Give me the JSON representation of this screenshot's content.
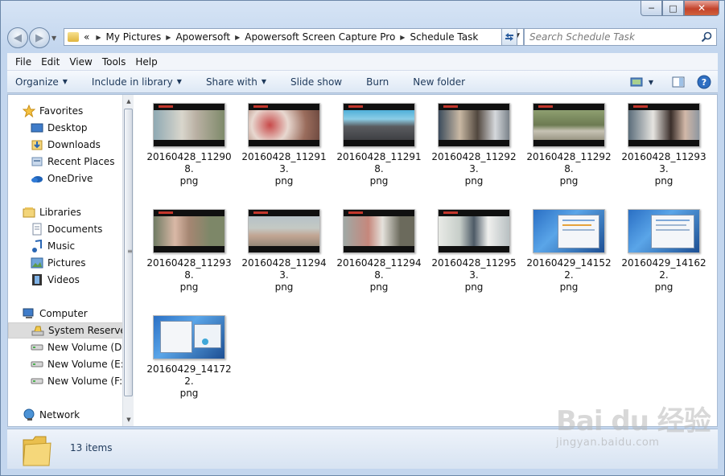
{
  "window": {
    "caption": {
      "minimize": "─",
      "maximize": "□",
      "close": "✕"
    }
  },
  "navigation": {
    "back_icon": "back-arrow-icon",
    "forward_icon": "forward-arrow-icon",
    "breadcrumb_prefix": "«",
    "breadcrumb": [
      "My Pictures",
      "Apowersoft",
      "Apowersoft Screen Capture Pro",
      "Schedule Task"
    ],
    "search_placeholder": "Search Schedule Task"
  },
  "menubar": [
    "File",
    "Edit",
    "View",
    "Tools",
    "Help"
  ],
  "toolbar": {
    "organize": "Organize",
    "include_in_library": "Include in library",
    "share_with": "Share with",
    "slide_show": "Slide show",
    "burn": "Burn",
    "new_folder": "New folder"
  },
  "nav_pane": {
    "favorites": {
      "label": "Favorites",
      "items": [
        "Desktop",
        "Downloads",
        "Recent Places",
        "OneDrive"
      ]
    },
    "libraries": {
      "label": "Libraries",
      "items": [
        "Documents",
        "Music",
        "Pictures",
        "Videos"
      ]
    },
    "computer": {
      "label": "Computer",
      "items": [
        "System Reserved",
        "New Volume (D:)",
        "New Volume (E:)",
        "New Volume (F:)"
      ]
    },
    "network": {
      "label": "Network"
    }
  },
  "files": [
    {
      "name": "20160428_112908.png",
      "line1": "20160428_112908.",
      "line2": "png"
    },
    {
      "name": "20160428_112913.png",
      "line1": "20160428_112913.",
      "line2": "png"
    },
    {
      "name": "20160428_112918.png",
      "line1": "20160428_112918.",
      "line2": "png"
    },
    {
      "name": "20160428_112923.png",
      "line1": "20160428_112923.",
      "line2": "png"
    },
    {
      "name": "20160428_112928.png",
      "line1": "20160428_112928.",
      "line2": "png"
    },
    {
      "name": "20160428_112933.png",
      "line1": "20160428_112933.",
      "line2": "png"
    },
    {
      "name": "20160428_112938.png",
      "line1": "20160428_112938.",
      "line2": "png"
    },
    {
      "name": "20160428_112943.png",
      "line1": "20160428_112943.",
      "line2": "png"
    },
    {
      "name": "20160428_112948.png",
      "line1": "20160428_112948.",
      "line2": "png"
    },
    {
      "name": "20160428_112953.png",
      "line1": "20160428_112953.",
      "line2": "png"
    },
    {
      "name": "20160429_141522.png",
      "line1": "20160429_141522.",
      "line2": "png"
    },
    {
      "name": "20160429_141622.png",
      "line1": "20160429_141622.",
      "line2": "png"
    },
    {
      "name": "20160429_141722.png",
      "line1": "20160429_141722.",
      "line2": "png"
    }
  ],
  "status": {
    "item_count": "13 items"
  },
  "watermark": {
    "logo": "Bai du 经验",
    "url": "jingyan.baidu.com"
  }
}
